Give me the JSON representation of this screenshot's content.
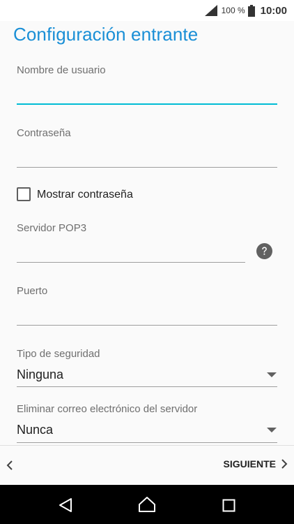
{
  "status_bar": {
    "battery_percent": "100 %",
    "time": "10:00"
  },
  "page": {
    "title": "Configuración entrante"
  },
  "form": {
    "username": {
      "label": "Nombre de usuario",
      "value": ""
    },
    "password": {
      "label": "Contraseña",
      "value": ""
    },
    "show_password": {
      "label": "Mostrar contraseña",
      "checked": false
    },
    "pop3_server": {
      "label": "Servidor POP3",
      "value": ""
    },
    "port": {
      "label": "Puerto",
      "value": ""
    },
    "security_type": {
      "label": "Tipo de seguridad",
      "value": "Ninguna"
    },
    "delete_from_server": {
      "label": "Eliminar correo electrónico del servidor",
      "value": "Nunca"
    }
  },
  "bottom_bar": {
    "next_label": "SIGUIENTE"
  },
  "icons": {
    "signal": "signal-icon",
    "battery": "battery-icon",
    "help": "help-icon",
    "dropdown": "dropdown-arrow-icon",
    "back": "chevron-left-icon",
    "next": "chevron-right-icon",
    "nav_back": "nav-back-icon",
    "nav_home": "nav-home-icon",
    "nav_recents": "nav-recents-icon"
  },
  "colors": {
    "accent": "#1a8fd6",
    "focus": "#00bcd4",
    "label": "#6f6f6f"
  }
}
